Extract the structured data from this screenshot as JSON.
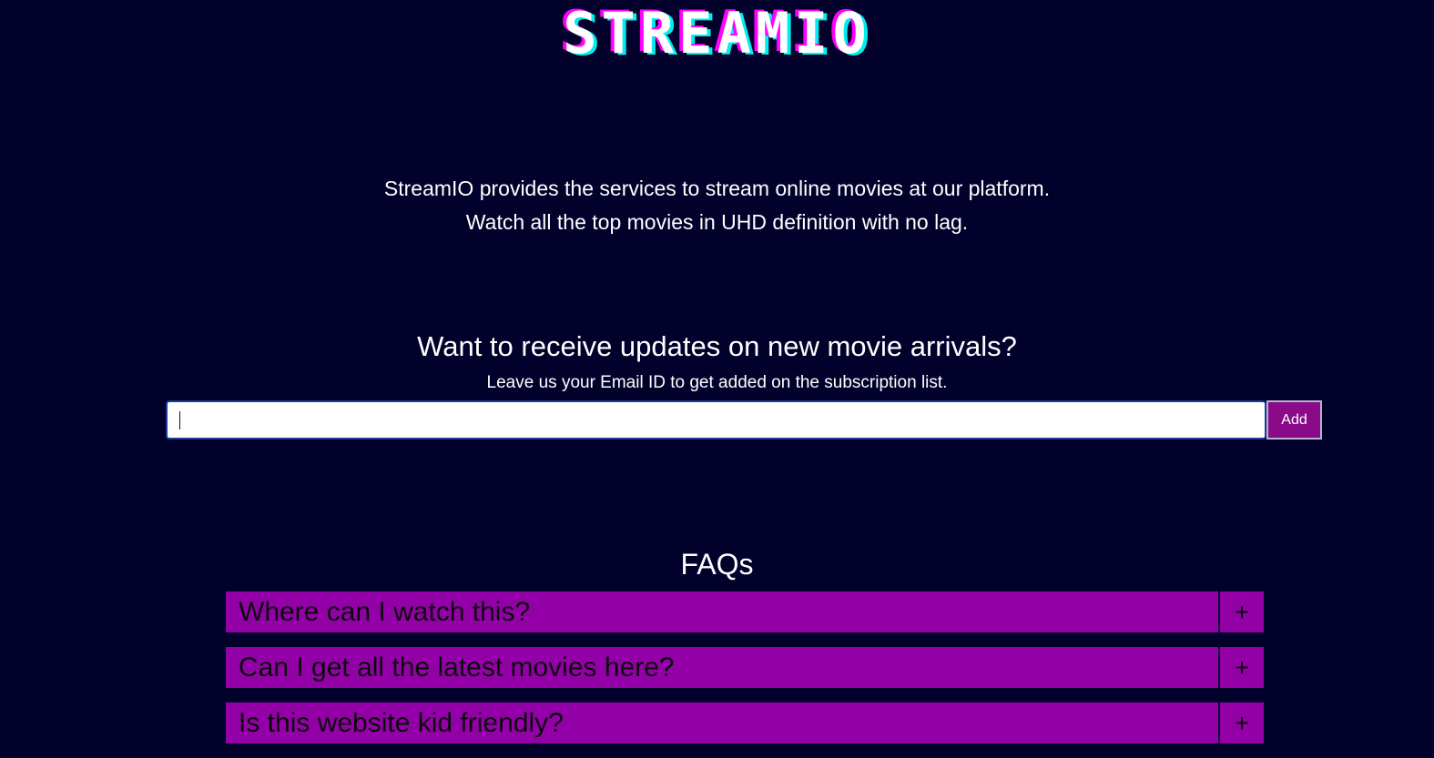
{
  "header": {
    "logo": "STREAMIO"
  },
  "intro": {
    "line1": "StreamIO provides the services to stream online movies at our platform.",
    "line2": "Watch all the top movies in UHD definition with no lag."
  },
  "subscribe": {
    "title": "Want to receive updates on new movie arrivals?",
    "description": "Leave us your Email ID to get added on the subscription list.",
    "email_value": "",
    "button_label": "Add"
  },
  "faq": {
    "title": "FAQs",
    "items": [
      {
        "question": "Where can I watch this?",
        "toggle": "+"
      },
      {
        "question": "Can I get all the latest movies here?",
        "toggle": "+"
      },
      {
        "question": "Is this website kid friendly?",
        "toggle": "+"
      }
    ]
  },
  "colors": {
    "background": "#01012b",
    "accent": "#9400a8",
    "logo_shadow_left": "#ff00ff",
    "logo_shadow_right": "#00eeee"
  }
}
